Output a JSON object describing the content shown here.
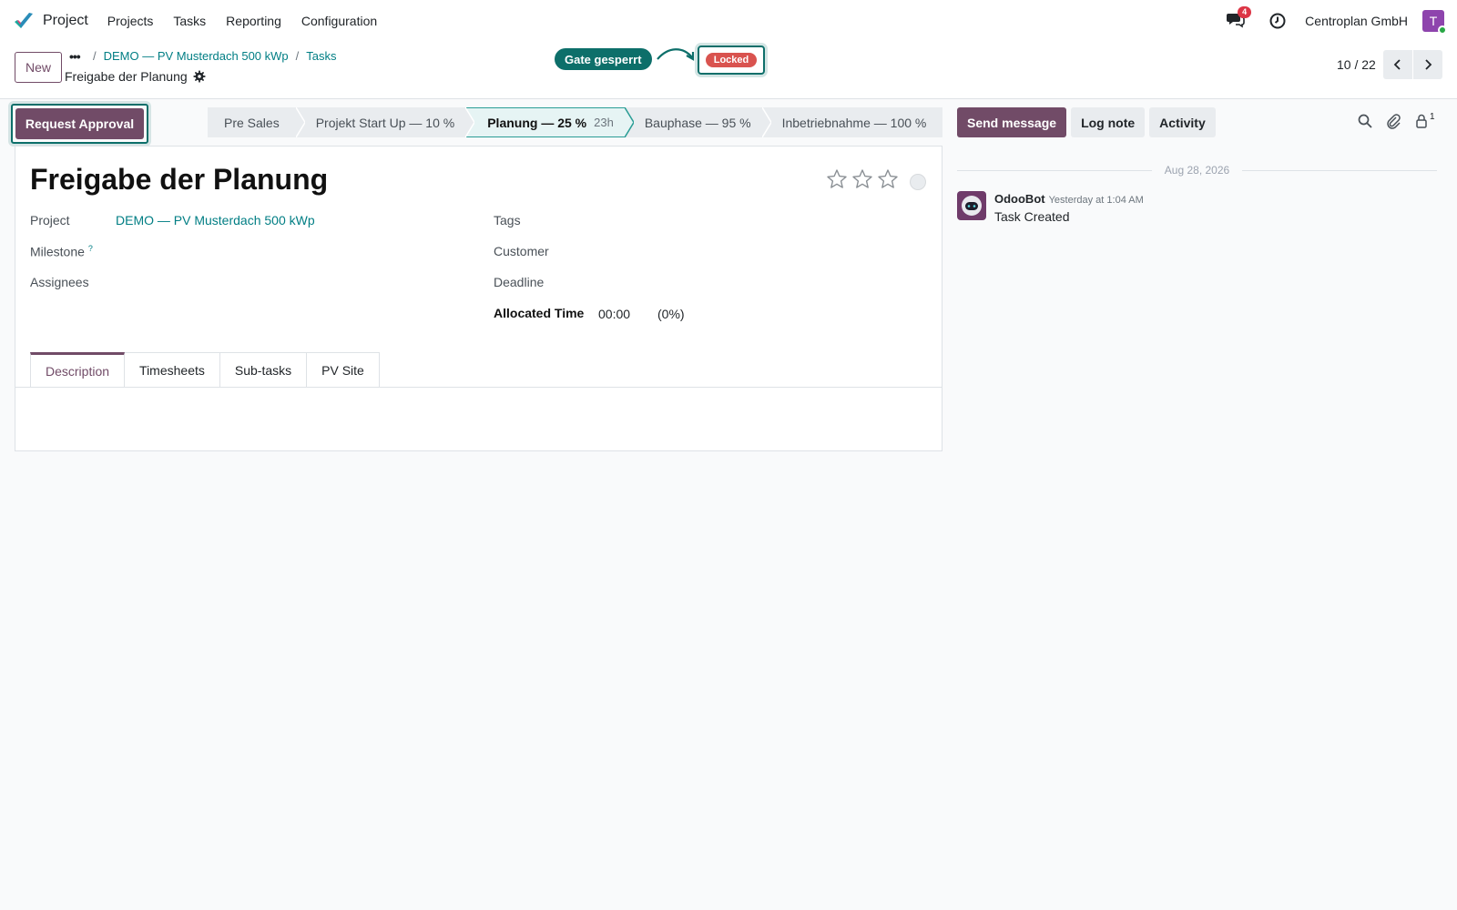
{
  "navbar": {
    "app_name": "Project",
    "menu": [
      "Projects",
      "Tasks",
      "Reporting",
      "Configuration"
    ],
    "chat_badge": "4",
    "company": "Centroplan GmbH",
    "avatar_letter": "T"
  },
  "control": {
    "new_label": "New",
    "more_label": "•••",
    "breadcrumb": [
      "DEMO — PV Musterdach 500 kWp",
      "Tasks"
    ],
    "record_title": "Freigabe der Planung",
    "gate_label": "Gate gesperrt",
    "locked_label": "Locked",
    "pager": "10 / 22"
  },
  "statusbar": {
    "request_label": "Request Approval",
    "stages": [
      {
        "label": "Pre Sales",
        "duration": ""
      },
      {
        "label": "Projekt Start Up — 10 %",
        "duration": ""
      },
      {
        "label": "Planung — 25 %",
        "duration": "23h"
      },
      {
        "label": "Bauphase — 95 %",
        "duration": ""
      },
      {
        "label": "Inbetriebnahme — 100 %",
        "duration": ""
      }
    ],
    "active_index": 2
  },
  "form": {
    "title": "Freigabe der Planung",
    "priority_stars": 0,
    "priority_max": 3,
    "fields": {
      "project_label": "Project",
      "project_value": "DEMO — PV Musterdach 500 kWp",
      "milestone_label": "Milestone",
      "milestone_help": "?",
      "assignees_label": "Assignees",
      "tags_label": "Tags",
      "customer_label": "Customer",
      "deadline_label": "Deadline",
      "allocated_label": "Allocated Time",
      "allocated_value": "00:00",
      "allocated_percent": "(0%)"
    },
    "tabs": [
      "Description",
      "Timesheets",
      "Sub-tasks",
      "PV Site"
    ],
    "active_tab": 0
  },
  "chatter": {
    "send_label": "Send message",
    "log_label": "Log note",
    "activity_label": "Activity",
    "followers_count": "1",
    "date": "Aug 28, 2026",
    "message": {
      "author": "OdooBot",
      "time": "Yesterday at 1:04 AM",
      "text": "Task Created"
    }
  },
  "colors": {
    "brand": "#714b67",
    "link": "#017e84",
    "gate": "#0d6f6a",
    "locked": "#d9534f"
  }
}
